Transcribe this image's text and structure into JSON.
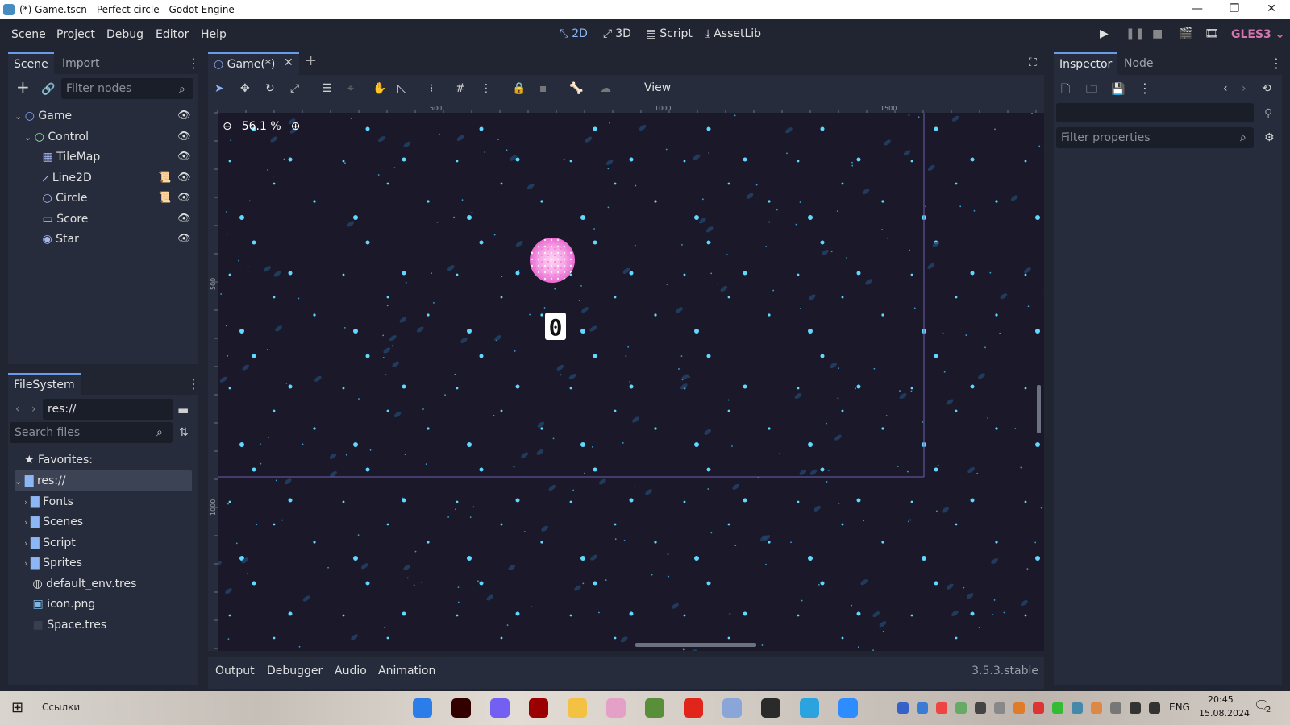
{
  "window": {
    "title": "(*) Game.tscn - Perfect circle - Godot Engine",
    "controls": [
      "—",
      "❐",
      "✕"
    ]
  },
  "menus": [
    "Scene",
    "Project",
    "Debug",
    "Editor",
    "Help"
  ],
  "modes": [
    {
      "label": "2D",
      "active": true
    },
    {
      "label": "3D",
      "active": false
    },
    {
      "label": "Script",
      "active": false
    },
    {
      "label": "AssetLib",
      "active": false
    }
  ],
  "renderer": "GLES3",
  "scene_dock": {
    "tabs": [
      "Scene",
      "Import"
    ],
    "filter_placeholder": "Filter nodes",
    "nodes": [
      {
        "name": "Game",
        "depth": 0,
        "color": "#8da5f3",
        "has_script": false
      },
      {
        "name": "Control",
        "depth": 1,
        "color": "#8eef97",
        "has_script": false
      },
      {
        "name": "TileMap",
        "depth": 2,
        "color": "#a5b7f3",
        "has_script": false
      },
      {
        "name": "Line2D",
        "depth": 2,
        "color": "#a5b7f3",
        "has_script": true
      },
      {
        "name": "Circle",
        "depth": 2,
        "color": "#a5b7f3",
        "has_script": true
      },
      {
        "name": "Score",
        "depth": 2,
        "color": "#8eef97",
        "has_script": false
      },
      {
        "name": "Star",
        "depth": 2,
        "color": "#a5b7f3",
        "has_script": false
      }
    ]
  },
  "filesystem": {
    "title": "FileSystem",
    "path": "res://",
    "search_placeholder": "Search files",
    "favorites": "Favorites:",
    "items": [
      {
        "name": "res://",
        "depth": 0,
        "kind": "folder",
        "selected": true
      },
      {
        "name": "Fonts",
        "depth": 1,
        "kind": "folder"
      },
      {
        "name": "Scenes",
        "depth": 1,
        "kind": "folder"
      },
      {
        "name": "Script",
        "depth": 1,
        "kind": "folder"
      },
      {
        "name": "Sprites",
        "depth": 1,
        "kind": "folder"
      },
      {
        "name": "default_env.tres",
        "depth": 1,
        "kind": "env"
      },
      {
        "name": "icon.png",
        "depth": 1,
        "kind": "image"
      },
      {
        "name": "Space.tres",
        "depth": 1,
        "kind": "resource"
      }
    ]
  },
  "editor": {
    "tab": "Game(*)",
    "view_menu": "View",
    "zoom": "56.1 %",
    "ruler_ticks_x": [
      "500",
      "1000",
      "1500"
    ],
    "ruler_ticks_y": [
      "500",
      "1000"
    ],
    "score": "0"
  },
  "bottom_panel": {
    "tabs": [
      "Output",
      "Debugger",
      "Audio",
      "Animation"
    ],
    "version": "3.5.3.stable"
  },
  "inspector": {
    "tabs": [
      "Inspector",
      "Node"
    ],
    "filter_placeholder": "Filter properties"
  },
  "taskbar": {
    "search": "Ссылки",
    "lang": "ENG",
    "time": "20:45",
    "date": "15.08.2024",
    "notifications": "2"
  }
}
